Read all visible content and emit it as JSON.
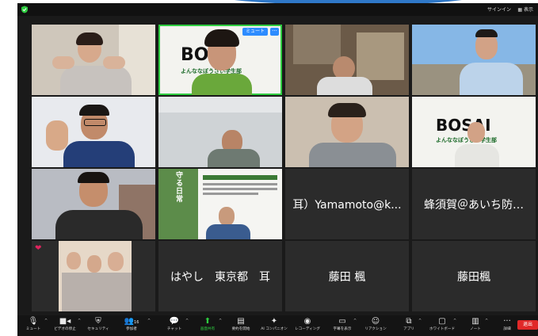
{
  "topbar": {
    "signin_label": "サインイン",
    "view_label": "表示"
  },
  "tiles": {
    "t2": {
      "bosai": "BO",
      "bosai_sub": "よんななぼうさい学生部",
      "mute_label": "ミュート",
      "more_label": "···"
    },
    "t8": {
      "bosai": "BOSAI",
      "bosai_sub": "よんななぼうさい学生部"
    },
    "t10": {
      "poster_title": "守る日常"
    },
    "t11": {
      "name": "耳）Yamamoto@k..."
    },
    "t12": {
      "name": "蜂須賀＠あいち防…"
    },
    "t13": {
      "reaction": "❤"
    },
    "t14": {
      "name": "はやし　東京都　耳"
    },
    "t15": {
      "name": "藤田 楓"
    },
    "t16": {
      "name": "藤田楓"
    }
  },
  "toolbar": {
    "participant_count": "16",
    "items": [
      {
        "label": "ミュート",
        "icon": "microphone-icon"
      },
      {
        "label": "ビデオの停止",
        "icon": "camera-icon"
      },
      {
        "label": "セキュリティ",
        "icon": "shield-icon"
      },
      {
        "label": "参加者",
        "icon": "participants-icon"
      },
      {
        "label": "チャット",
        "icon": "chat-icon"
      },
      {
        "label": "画面共有",
        "icon": "share-screen-icon"
      },
      {
        "label": "要約を開始",
        "icon": "summary-icon"
      },
      {
        "label": "AI コンパニオン",
        "icon": "sparkle-icon"
      },
      {
        "label": "レコーディング",
        "icon": "record-icon"
      },
      {
        "label": "字幕を表示",
        "icon": "captions-icon"
      },
      {
        "label": "リアクション",
        "icon": "smile-icon"
      },
      {
        "label": "アプリ",
        "icon": "apps-icon"
      },
      {
        "label": "ホワイトボード",
        "icon": "whiteboard-icon"
      },
      {
        "label": "ノート",
        "icon": "notes-icon"
      },
      {
        "label": "詳細",
        "icon": "more-icon"
      }
    ],
    "end_label": "退出"
  },
  "colors": {
    "accent": "#2d8cff",
    "active_border": "#2ecc40",
    "end": "#e02828",
    "tile_bg": "#2b2b2b"
  }
}
